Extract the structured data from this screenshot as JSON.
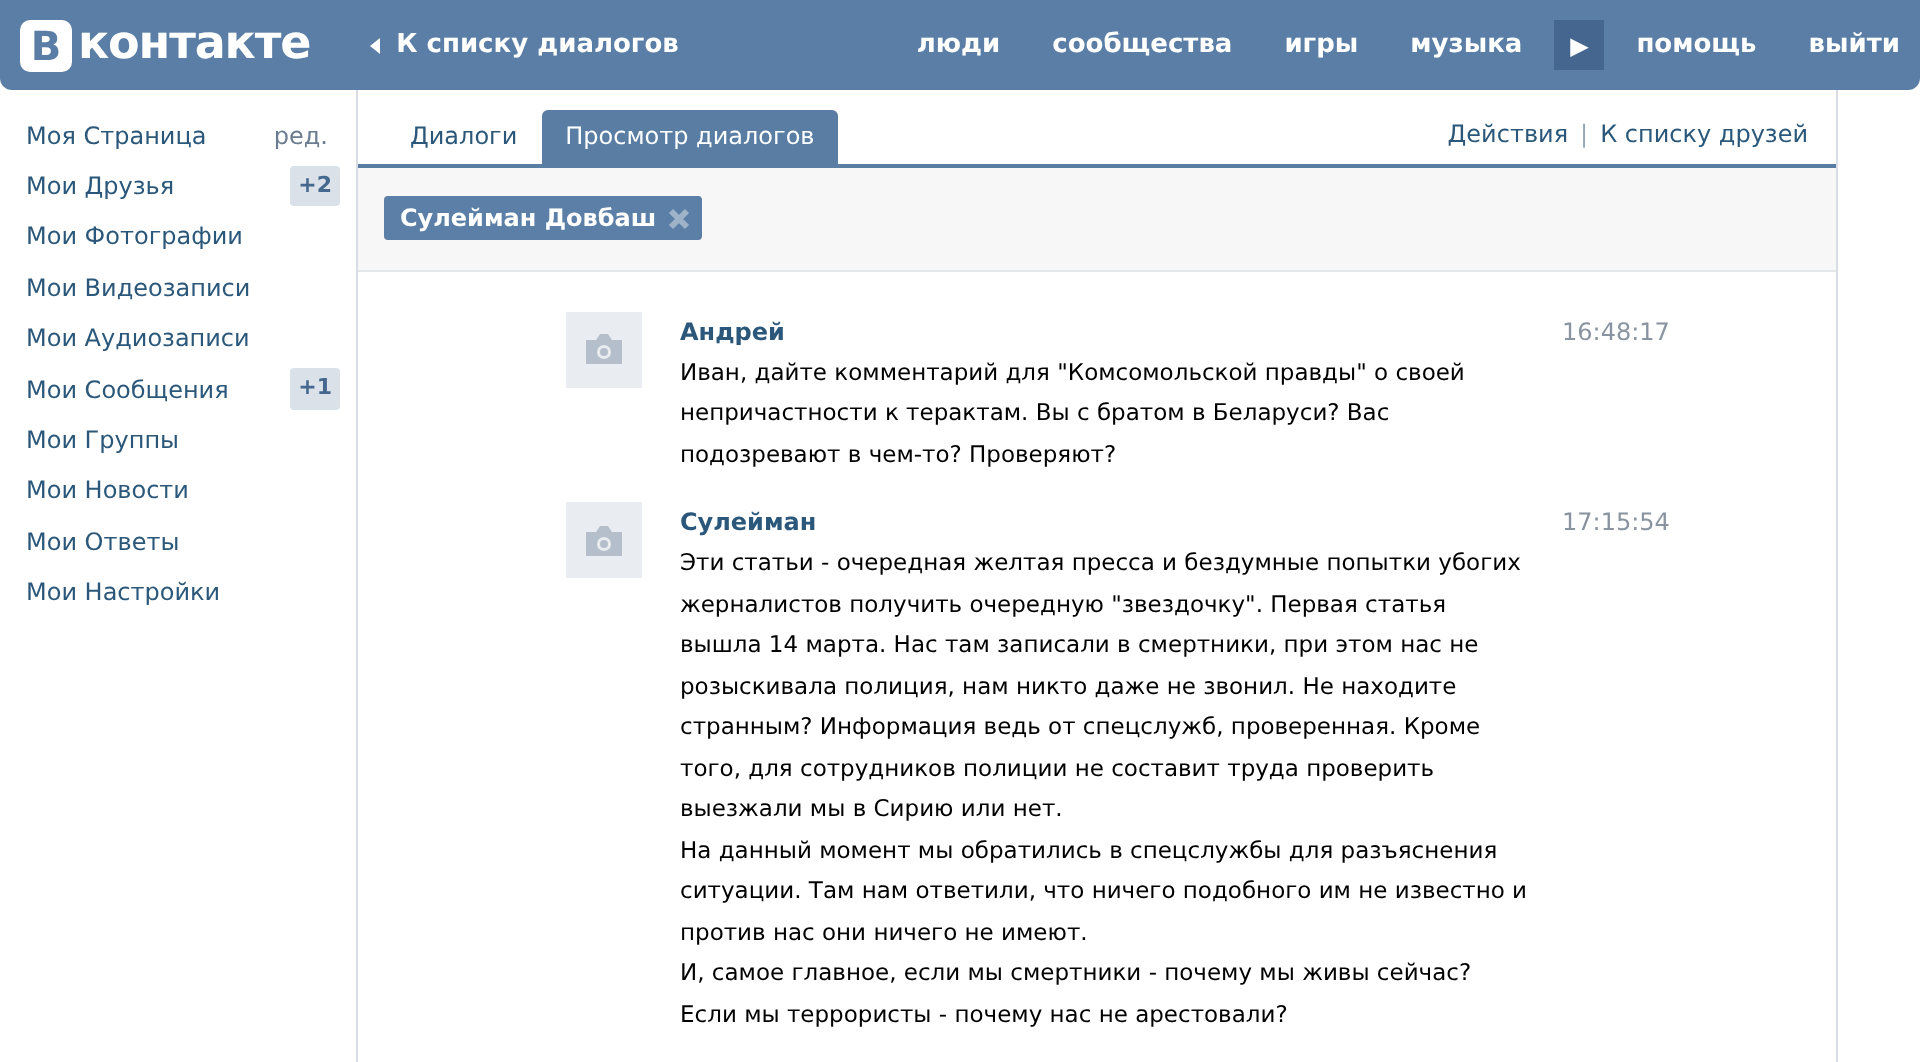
{
  "header": {
    "logo_letter": "В",
    "logo_text": "контакте",
    "back_link": "К списку диалогов",
    "nav": [
      "люди",
      "сообщества",
      "игры",
      "музыка"
    ],
    "nav_more": "▶",
    "nav_end": [
      "помощь",
      "выйти"
    ]
  },
  "sidebar": {
    "items": [
      {
        "label": "Моя Страница",
        "extra": "ред."
      },
      {
        "label": "Мои Друзья",
        "badge": "+2"
      },
      {
        "label": "Мои Фотографии"
      },
      {
        "label": "Мои Видеозаписи"
      },
      {
        "label": "Мои Аудиозаписи"
      },
      {
        "label": "Мои Сообщения",
        "badge": "+1"
      },
      {
        "label": "Мои Группы"
      },
      {
        "label": "Мои Новости"
      },
      {
        "label": "Мои Ответы"
      },
      {
        "label": "Мои Настройки"
      }
    ]
  },
  "tabs": [
    {
      "label": "Диалоги",
      "selected": false
    },
    {
      "label": "Просмотр диалогов",
      "selected": true
    }
  ],
  "actions": [
    "Действия",
    "К списку друзей"
  ],
  "actions_separator": "|",
  "filter_token": {
    "label": "Сулейман Довбаш"
  },
  "messages": [
    {
      "author": "Андрей",
      "time": "16:48:17",
      "lines": [
        "Иван, дайте комментарий для \"Комсомольской правды\" о своей",
        "непричастности к терактам. Вы с братом в Беларуси? Вас",
        "подозревают в чем-то? Проверяют?"
      ]
    },
    {
      "author": "Сулейман",
      "time": "17:15:54",
      "lines": [
        "Эти статьи - очередная желтая пресса и бездумные попытки убогих",
        "жерналистов получить очередную \"звездочку\". Первая статья",
        "вышла 14 марта. Нас там записали в смертники, при этом нас не",
        "розыскивала полиция, нам никто даже не звонил. Не находите",
        "странным? Информация ведь от спецслужб, проверенная. Кроме",
        "того, для сотрудников полиции не составит труда проверить",
        "выезжали мы в Сирию или нет.",
        "На данный момент мы обратились в спецслужбы для разъяснения",
        "ситуации. Там нам ответили, что ничего подобного им не известно и",
        "против нас они ничего не имеют.",
        "И, самое главное, если мы смертники - почему мы живы сейчас?",
        "Если мы террористы - почему нас не арестовали?"
      ]
    }
  ]
}
